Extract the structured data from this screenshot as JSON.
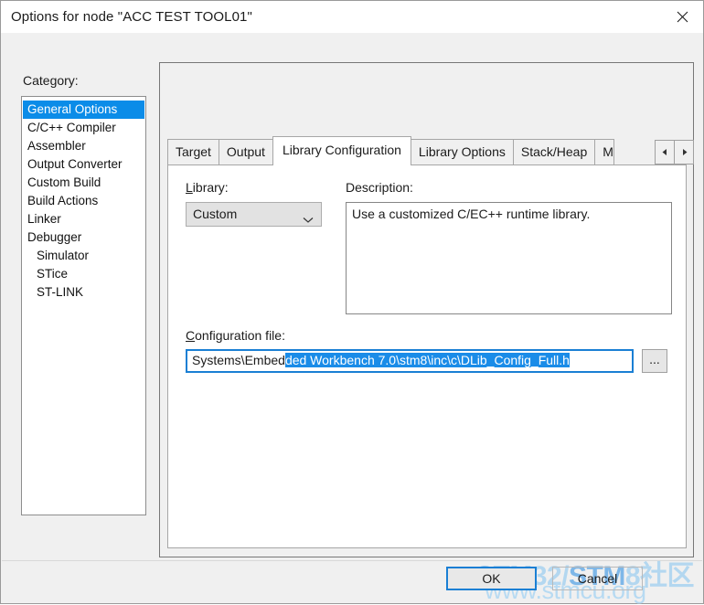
{
  "window": {
    "title": "Options for node \"ACC TEST TOOL01\"",
    "close_icon": "close-icon"
  },
  "category": {
    "label": "Category:",
    "items": [
      {
        "label": "General Options",
        "selected": true,
        "indent": false
      },
      {
        "label": "C/C++ Compiler",
        "selected": false,
        "indent": false
      },
      {
        "label": "Assembler",
        "selected": false,
        "indent": false
      },
      {
        "label": "Output Converter",
        "selected": false,
        "indent": false
      },
      {
        "label": "Custom Build",
        "selected": false,
        "indent": false
      },
      {
        "label": "Build Actions",
        "selected": false,
        "indent": false
      },
      {
        "label": "Linker",
        "selected": false,
        "indent": false
      },
      {
        "label": "Debugger",
        "selected": false,
        "indent": false
      },
      {
        "label": "Simulator",
        "selected": false,
        "indent": true
      },
      {
        "label": "STice",
        "selected": false,
        "indent": true
      },
      {
        "label": "ST-LINK",
        "selected": false,
        "indent": true
      }
    ]
  },
  "tabs": {
    "items": [
      {
        "label": "Target",
        "active": false,
        "clipped": false
      },
      {
        "label": "Output",
        "active": false,
        "clipped": false
      },
      {
        "label": "Library Configuration",
        "active": true,
        "clipped": false
      },
      {
        "label": "Library Options",
        "active": false,
        "clipped": false
      },
      {
        "label": "Stack/Heap",
        "active": false,
        "clipped": false
      },
      {
        "label": "M",
        "active": false,
        "clipped": true
      }
    ],
    "scroll_left_icon": "triangle-left-icon",
    "scroll_right_icon": "triangle-right-icon"
  },
  "library": {
    "label": "Library:",
    "accel": "L",
    "label_rest": "ibrary:",
    "value": "Custom",
    "dropdown_icon": "chevron-down-icon"
  },
  "description": {
    "label": "Description:",
    "text": "Use a customized C/EC++ runtime library."
  },
  "config_file": {
    "accel": "C",
    "label_rest": "onfiguration file:",
    "value_unselected": "Systems\\Embed",
    "value_selected": "ded Workbench 7.0\\stm8\\inc\\c\\DLib_Config_Full.h",
    "full_value": "Systems\\Embedded Workbench 7.0\\stm8\\inc\\c\\DLib_Config_Full.h",
    "browse_label": "..."
  },
  "footer": {
    "ok_label": "OK",
    "cancel_label": "Cancel"
  },
  "watermark": {
    "part1": "STM",
    "part2": "32/",
    "part3": "STM",
    "part4": "8社区",
    "line2": "www.stmcu.org",
    "color_dark": "#7eb7e8",
    "color_light": "#b3d7f0"
  },
  "colors": {
    "selection_blue": "#0b8ce8",
    "focus_blue": "#1a7fd4",
    "dialog_bg": "#f0f0f0"
  }
}
